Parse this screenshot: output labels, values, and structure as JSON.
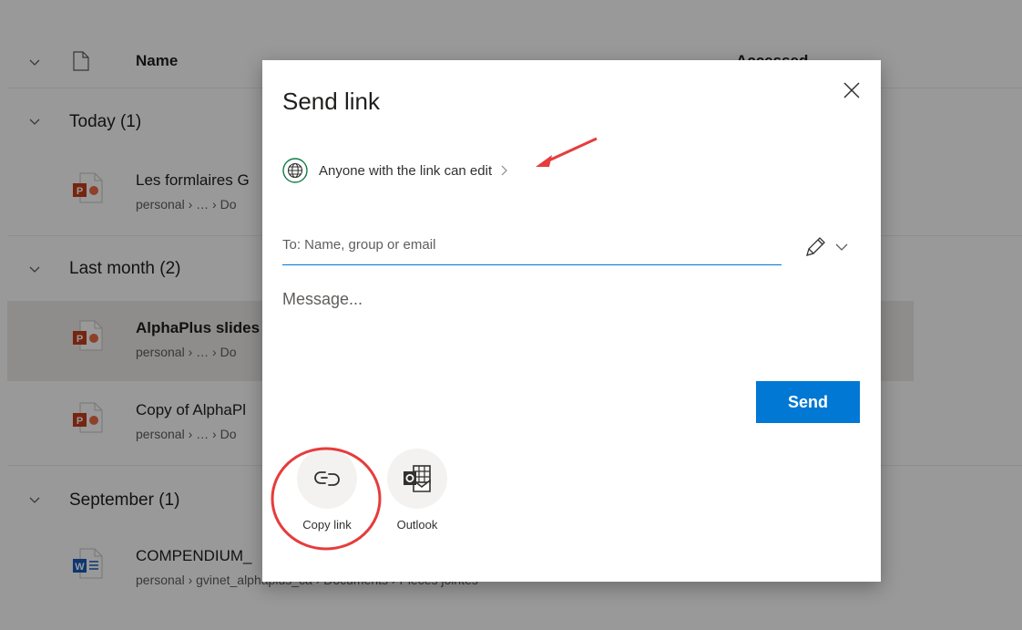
{
  "list": {
    "header": {
      "name_label": "Name",
      "accessed_label": "Accessed"
    },
    "groups": [
      {
        "title": "Today (1)",
        "files": [
          {
            "type": "pptx",
            "name": "Les formlaires G",
            "path": "personal › … › Do"
          }
        ]
      },
      {
        "title": "Last month (2)",
        "files": [
          {
            "type": "pptx",
            "name": "AlphaPlus slides",
            "path": "personal › … › Do",
            "selected": true
          },
          {
            "type": "pptx",
            "name": "Copy of AlphaPl",
            "path": "personal › … › Do"
          }
        ]
      },
      {
        "title": "September (1)",
        "files": [
          {
            "type": "docx",
            "name": "COMPENDIUM_",
            "path": "personal › gvinet_alphaplus_ca › Documents › Pièces jointes"
          }
        ]
      }
    ]
  },
  "dialog": {
    "title": "Send link",
    "permission": "Anyone with the link can edit",
    "to_placeholder": "To: Name, group or email",
    "message_placeholder": "Message...",
    "send_label": "Send",
    "share_options": [
      {
        "label": "Copy link",
        "icon": "link-icon"
      },
      {
        "label": "Outlook",
        "icon": "outlook-icon"
      }
    ]
  },
  "colors": {
    "accent": "#0078d4",
    "annotation": "#e63c3c",
    "ppt": "#c43e1c",
    "word": "#185abd",
    "globe": "#107c41"
  }
}
